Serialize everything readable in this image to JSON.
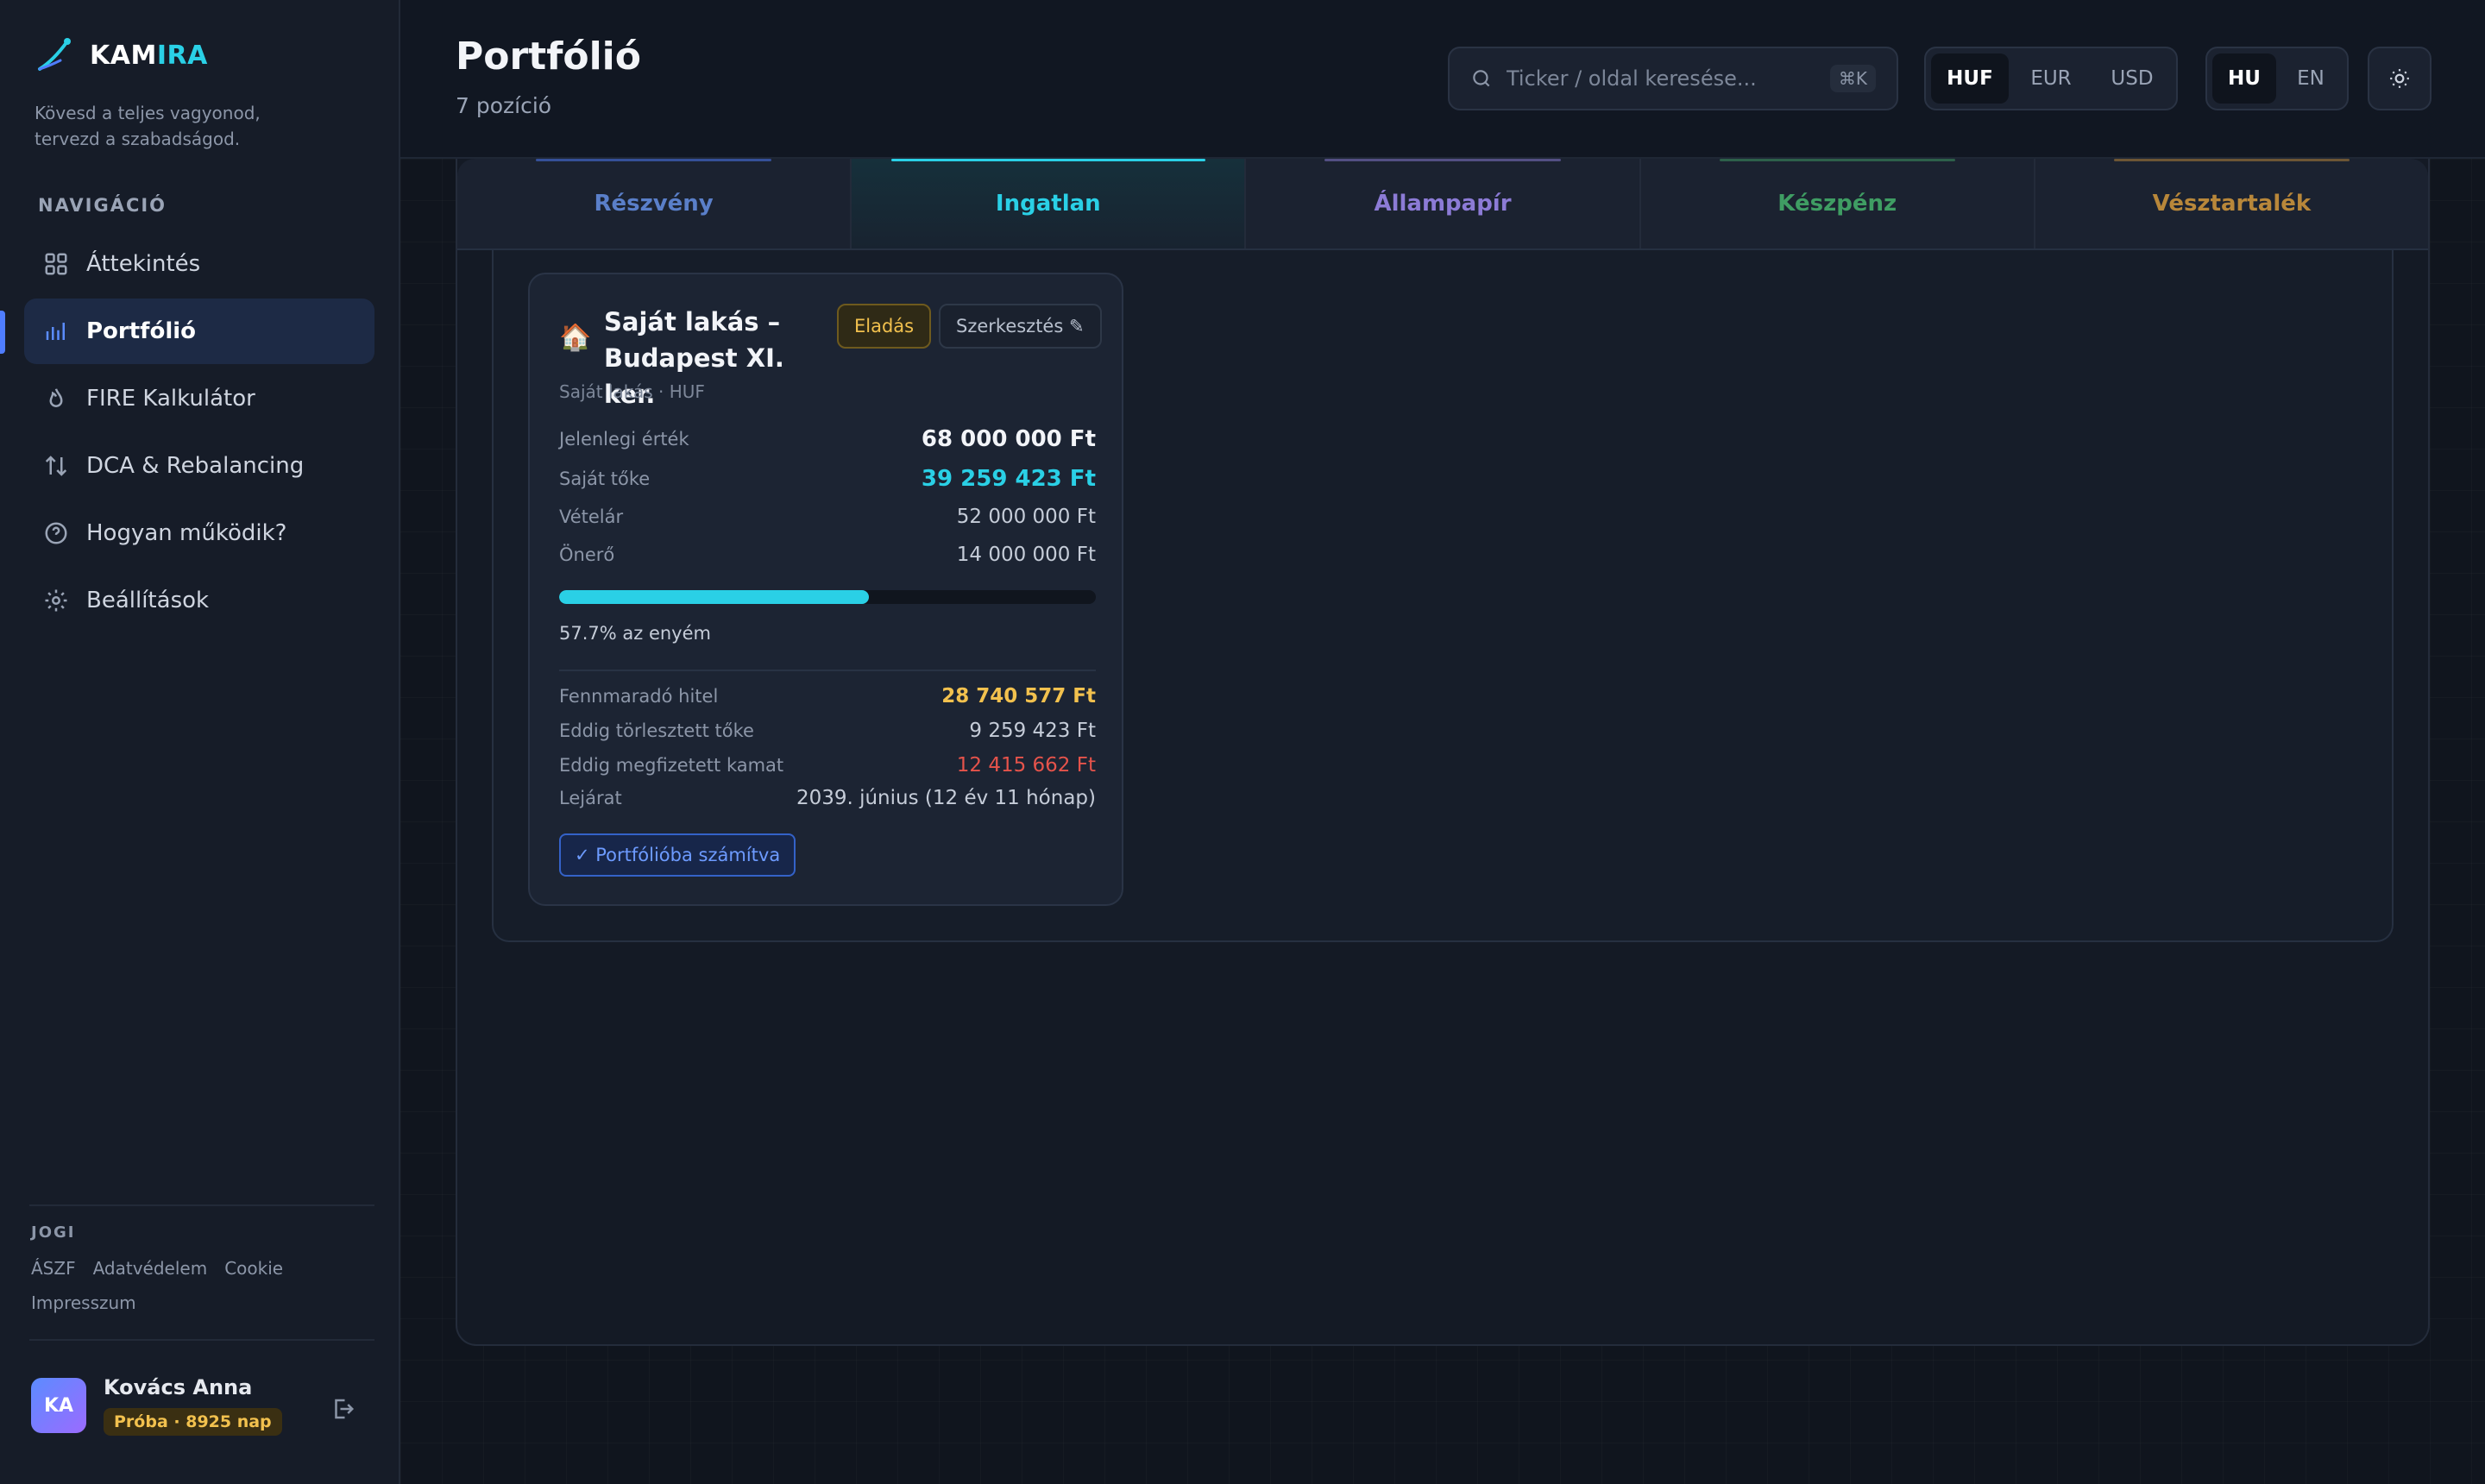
{
  "app": {
    "name_part1": "KAM",
    "name_part2": "IRA",
    "tagline": "Kövesd a teljes vagyonod, tervezd a szabadságod."
  },
  "sidebar": {
    "nav_title": "NAVIGÁCIÓ",
    "items": [
      {
        "label": "Áttekintés",
        "icon": "grid-icon"
      },
      {
        "label": "Portfólió",
        "icon": "bar-chart-icon",
        "active": true
      },
      {
        "label": "FIRE Kalkulátor",
        "icon": "flame-icon"
      },
      {
        "label": "DCA & Rebalancing",
        "icon": "arrows-updown-icon"
      },
      {
        "label": "Hogyan működik?",
        "icon": "help-circle-icon"
      },
      {
        "label": "Beállítások",
        "icon": "gear-icon"
      }
    ],
    "legal_title": "JOGI",
    "legal_links": [
      "ÁSZF",
      "Adatvédelem",
      "Cookie",
      "Impresszum"
    ],
    "user": {
      "initials": "KA",
      "name": "Kovács Anna",
      "badge": "Próba · 8925 nap"
    }
  },
  "header": {
    "title": "Portfólió",
    "subtitle": "7 pozíció",
    "search": {
      "placeholder": "Ticker / oldal keresése...",
      "shortcut": "⌘K"
    },
    "currencies": [
      "HUF",
      "EUR",
      "USD"
    ],
    "currency_selected": "HUF",
    "languages": [
      "HU",
      "EN"
    ],
    "language_selected": "HU",
    "theme_icon": "sun-icon"
  },
  "tabs": [
    {
      "label": "Részvény",
      "color": "#5a7fc9",
      "glow": "#4f7dff"
    },
    {
      "label": "Ingatlan",
      "color": "#2ad0e6",
      "glow": "#2ad0e6",
      "active": true
    },
    {
      "label": "Állampapír",
      "color": "#8c7bd6",
      "glow": "#8c7bd6"
    },
    {
      "label": "Készpénz",
      "color": "#3f9d63",
      "glow": "#3f9d63"
    },
    {
      "label": "Vésztartalék",
      "color": "#b8873a",
      "glow": "#c08a3a"
    }
  ],
  "property": {
    "icon": "🏠",
    "title": "Saját lakás – Budapest XI. ker.",
    "subtitle": "Saját lakás · HUF",
    "sell_label": "Eladás",
    "edit_label": "Szerkesztés ✎",
    "rows": {
      "current_value": {
        "label": "Jelenlegi érték",
        "value": "68 000 000 Ft"
      },
      "equity": {
        "label": "Saját tőke",
        "value": "39 259 423 Ft"
      },
      "purchase_price": {
        "label": "Vételár",
        "value": "52 000 000 Ft"
      },
      "down_payment": {
        "label": "Önerő",
        "value": "14 000 000 Ft"
      }
    },
    "ownership_fraction": 0.577,
    "ownership_label": "57.7% az enyém",
    "loan": {
      "remaining": {
        "label": "Fennmaradó hitel",
        "value": "28 740 577 Ft"
      },
      "repaid": {
        "label": "Eddig törlesztett tőke",
        "value": "9 259 423 Ft"
      },
      "interest": {
        "label": "Eddig megfizetett kamat",
        "value": "12 415 662 Ft"
      },
      "maturity": {
        "label": "Lejárat",
        "value": "2039. június (12 év 11 hónap)"
      }
    },
    "counted_label": "✓ Portfólióba számítva"
  }
}
